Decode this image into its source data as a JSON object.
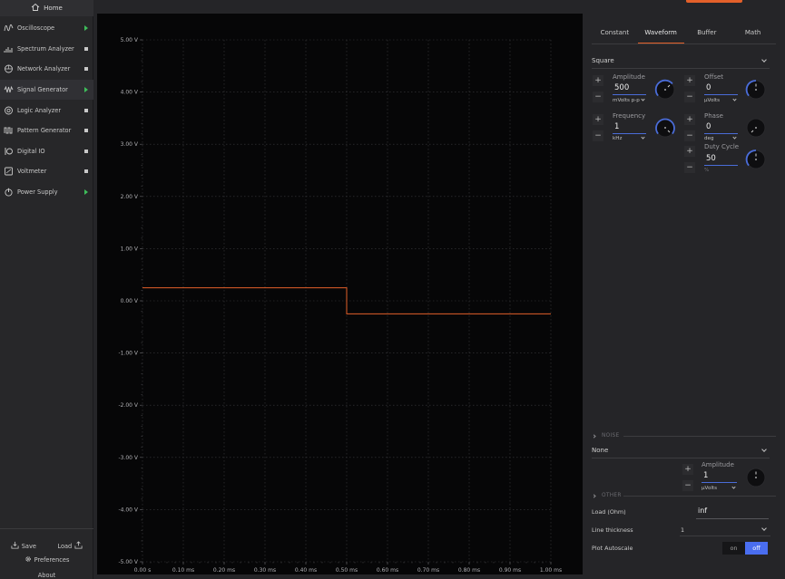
{
  "sidebar": {
    "home_label": "Home",
    "items": [
      {
        "label": "Oscilloscope",
        "icon": "oscilloscope-icon",
        "indicator": "play",
        "color": "#3ebd5a"
      },
      {
        "label": "Spectrum Analyzer",
        "icon": "spectrum-analyzer-icon",
        "indicator": "square"
      },
      {
        "label": "Network Analyzer",
        "icon": "network-analyzer-icon",
        "indicator": "square"
      },
      {
        "label": "Signal Generator",
        "icon": "signal-generator-icon",
        "indicator": "play",
        "active": true
      },
      {
        "label": "Logic Analyzer",
        "icon": "logic-analyzer-icon",
        "indicator": "square"
      },
      {
        "label": "Pattern Generator",
        "icon": "pattern-generator-icon",
        "indicator": "square"
      },
      {
        "label": "Digital IO",
        "icon": "digital-io-icon",
        "indicator": "square"
      },
      {
        "label": "Voltmeter",
        "icon": "voltmeter-icon",
        "indicator": "square"
      },
      {
        "label": "Power Supply",
        "icon": "power-supply-icon",
        "indicator": "play"
      }
    ],
    "save_label": "Save",
    "load_label": "Load",
    "preferences_label": "Preferences",
    "about_label": "About"
  },
  "plot": {
    "y_ticks": [
      "5.00 V",
      "4.00 V",
      "3.00 V",
      "2.00 V",
      "1.00 V",
      "0.00 V",
      "-1.00 V",
      "-2.00 V",
      "-3.00 V",
      "-4.00 V",
      "-5.00 V"
    ],
    "x_ticks": [
      "0.00 s",
      "0.10 ms",
      "0.20 ms",
      "0.30 ms",
      "0.40 ms",
      "0.50 ms",
      "0.60 ms",
      "0.70 ms",
      "0.80 ms",
      "0.90 ms",
      "1.00 ms"
    ],
    "trace_color": "#e3602a"
  },
  "chart_data": {
    "type": "line",
    "x": [
      0,
      0.5,
      0.5,
      1.0
    ],
    "x_unit": "ms",
    "series": [
      {
        "values": [
          0.25,
          0.25,
          -0.25,
          -0.25
        ]
      }
    ],
    "xlim": [
      0,
      1.0
    ],
    "ylim": [
      -5,
      5
    ],
    "grid": true
  },
  "panel": {
    "tabs": [
      "Constant",
      "Waveform",
      "Buffer",
      "Math"
    ],
    "active_tab": "Waveform",
    "waveform_type": "Square",
    "amplitude": {
      "label": "Amplitude",
      "value": "500",
      "unit": "mVolts p-p"
    },
    "offset": {
      "label": "Offset",
      "value": "0",
      "unit": "μVolts"
    },
    "frequency": {
      "label": "Frequency",
      "value": "1",
      "unit": "kHz"
    },
    "phase": {
      "label": "Phase",
      "value": "0",
      "unit": "deg"
    },
    "duty_cycle": {
      "label": "Duty Cycle",
      "value": "50",
      "unit": "%"
    },
    "noise": {
      "section_label": "NOISE",
      "type": "None",
      "amplitude": {
        "label": "Amplitude",
        "value": "1",
        "unit": "μVolts"
      }
    },
    "other": {
      "section_label": "OTHER",
      "load_label": "Load (Ohm)",
      "load_value": "inf",
      "line_thickness_label": "Line thickness",
      "line_thickness_value": "1",
      "plot_autoscale_label": "Plot Autoscale",
      "toggle_on": "on",
      "toggle_off": "off",
      "autoscale_state": "off"
    },
    "plus": "+",
    "minus": "−"
  },
  "colors": {
    "accent": "#e3602a",
    "knob_blue": "#4a6cd8",
    "active_green": "#3ebd5a"
  }
}
